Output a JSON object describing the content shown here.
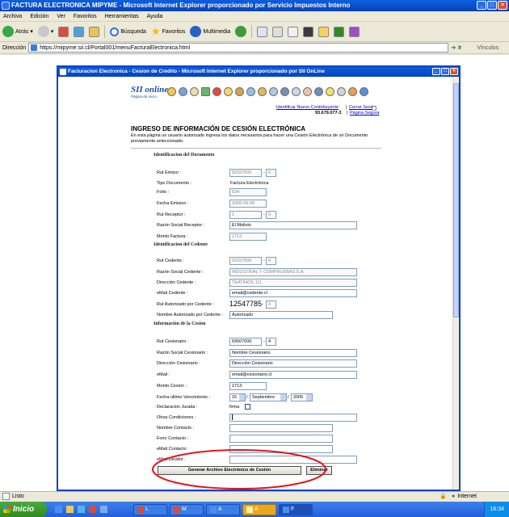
{
  "window": {
    "title": "FACTURA ELECTRONICA MIPYME - Microsoft Internet Explorer proporcionado por Servicio Impuestos Interno"
  },
  "menu": [
    "Archivo",
    "Edición",
    "Ver",
    "Favoritos",
    "Herramientas",
    "Ayuda"
  ],
  "toolbar": {
    "back": "Atrás",
    "search": "Búsqueda",
    "favorites": "Favoritos",
    "multimedia": "Multimedia"
  },
  "address": {
    "label": "Dirección",
    "url": "https://mipyme.sii.cl/Portal001/menuFacturaElectronica.html",
    "go": "Ir",
    "links": "Vínculos"
  },
  "popup": {
    "title": "Facturacion Electronica - Cesion de Credito - Microsoft Internet Explorer proporcionado por SII OnLine",
    "logo_text": "SII online",
    "logo_sub": "Página de inicio",
    "link_change": "Identificar Nuevo Contribuyente",
    "link_close": "Cerrar Sesión",
    "rut_user": "93.679.077-3",
    "link_secure": "Página Segura",
    "heading": "INGRESO DE INFORMACIÓN DE CESIÓN ELECTRÓNICA",
    "intro": "En esta página un usuario autorizado ingresa los datos necesarios para hacer una Cesión Electrónica de un Documento previamente seleccionado.",
    "sections": {
      "document": "Identificacion del Documento",
      "cedente": "Identificacion del Cedente",
      "cesion": "Información de la Cesion"
    },
    "document": {
      "rut_emisor_label": "Rut Emisor :",
      "rut_emisor": "92327000",
      "rut_emisor_dv": "6",
      "tipo_label": "Tipo Documento :",
      "tipo": "Factura Electrónica",
      "folio_label": "Folio :",
      "folio": "534",
      "fecha_label": "Fecha Emision :",
      "fecha": "2006-09-06",
      "rut_receptor_label": "Rut Receptor :",
      "rut_receptor": "1",
      "rut_receptor_dv": "9",
      "razon_receptor_label": "Razón Social Receptor :",
      "razon_receptor": "El Molinio",
      "monto_label": "Monto Factura :",
      "monto": "1713"
    },
    "cedente": {
      "rut_label": "Rut Cedente :",
      "rut": "92327000",
      "rut_dv": "6",
      "razon_label": "Razón Social Cedente :",
      "razon": "INDUSTRIAL Y COMPRUEBAS S.A.",
      "direccion_label": "Dirección Cedente :",
      "direccion": "TEATINOS 111",
      "email_label": "eMail Cedente :",
      "email": "email@cedente.cl",
      "rut_aut_label": "Rut Autorizado por Cedente :",
      "rut_aut": "12547785",
      "rut_aut_dv": "3",
      "nombre_aut_label": "Nombre Autorizado por Cedente :",
      "nombre_aut": "Autorizado"
    },
    "cesion": {
      "rut_label": "Rut Cesionario :",
      "rut": "69507000",
      "rut_dv": "4",
      "razon_label": "Razón Social Cesionario :",
      "razon": "Nombre Cesionario",
      "direccion_label": "Dirección Cesionario :",
      "direccion": "Dirección Cesionario",
      "email_label": "eMail :",
      "email": "email@cesionario.cl",
      "monto_label": "Monto Cesion :",
      "monto": "1713",
      "fecha_label": "Fecha ultimo Vencimiento :",
      "fecha_dia": "15",
      "fecha_mes": "Septiembre",
      "fecha_anio": "2005",
      "declaracion_label": "Declaracion Jurada :",
      "firma_label": "firma",
      "otras_label": "Otras Condiciones :",
      "nombre_contacto_label": "Nombre Contacto :",
      "fono_contacto_label": "Fono Contacto :",
      "email_contacto_label": "eMail Contacto :",
      "email_deudor_label": "eMail Deudor :"
    },
    "buttons": {
      "generar": "Generar Archivo Electrónico de Cesión",
      "eliminar": "Eliminar"
    }
  },
  "status": {
    "left": "Listo",
    "zone": "Internet"
  },
  "taskbar": {
    "start": "Inicio",
    "buttons": [
      "L",
      "M",
      "A",
      "A",
      "F"
    ],
    "clock": "16:34"
  }
}
